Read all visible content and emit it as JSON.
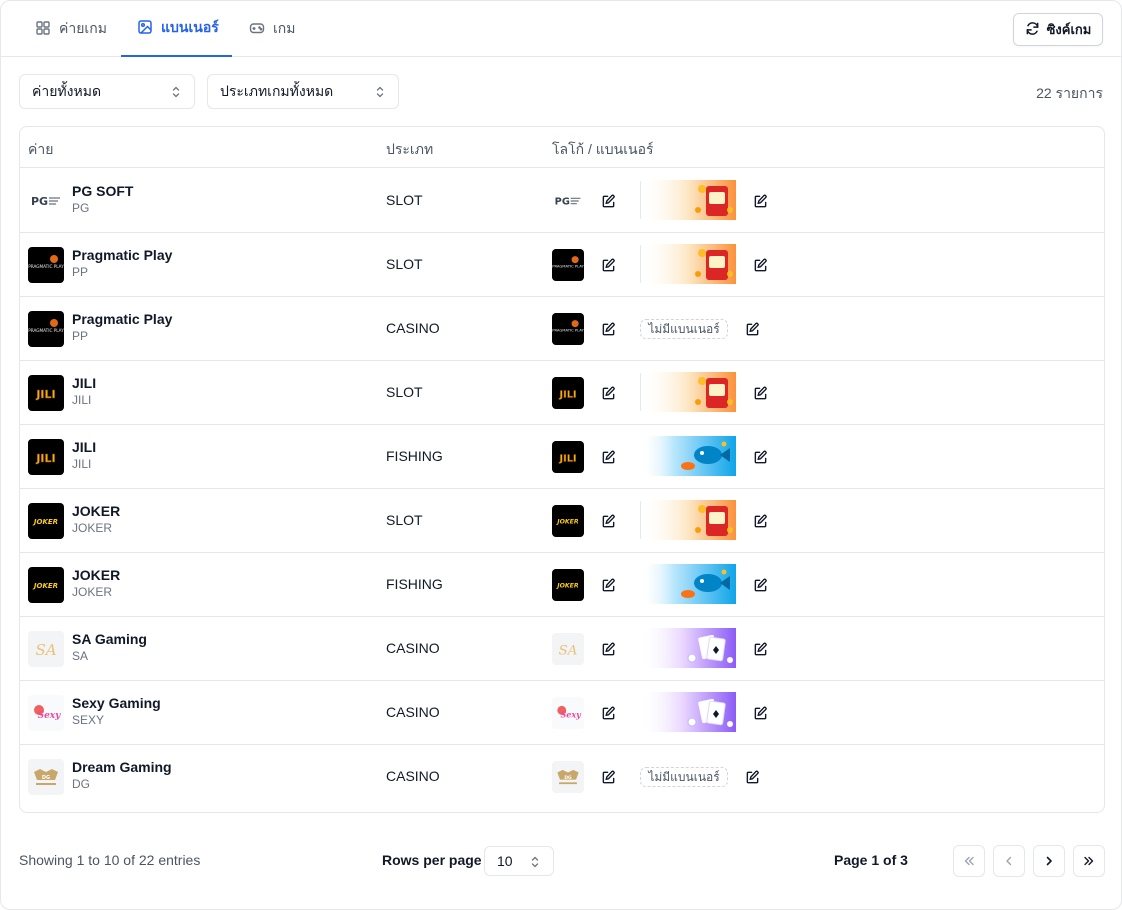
{
  "tabs": [
    {
      "label": "ค่ายเกม",
      "icon": "grid-icon",
      "active": false
    },
    {
      "label": "แบนเนอร์",
      "icon": "image-icon",
      "active": true
    },
    {
      "label": "เกม",
      "icon": "gamepad-icon",
      "active": false
    }
  ],
  "sync_button": {
    "label": "ซิงค์เกม",
    "icon": "refresh-icon"
  },
  "filters": {
    "provider": "ค่ายทั้งหมด",
    "game_type": "ประเภทเกมทั้งหมด"
  },
  "total_count": "22 รายการ",
  "table": {
    "headers": [
      "ค่าย",
      "ประเภท",
      "โลโก้ / แบนเนอร์"
    ],
    "no_banner_label": "ไม่มีแบนเนอร์",
    "rows": [
      {
        "name": "PG SOFT",
        "code": "PG",
        "type": "SLOT",
        "logo": "pg",
        "banner": "slot"
      },
      {
        "name": "Pragmatic Play",
        "code": "PP",
        "type": "SLOT",
        "logo": "pp",
        "banner": "slot"
      },
      {
        "name": "Pragmatic Play",
        "code": "PP",
        "type": "CASINO",
        "logo": "pp",
        "banner": "none"
      },
      {
        "name": "JILI",
        "code": "JILI",
        "type": "SLOT",
        "logo": "jili",
        "banner": "slot"
      },
      {
        "name": "JILI",
        "code": "JILI",
        "type": "FISHING",
        "logo": "jili",
        "banner": "fishing"
      },
      {
        "name": "JOKER",
        "code": "JOKER",
        "type": "SLOT",
        "logo": "joker",
        "banner": "slot"
      },
      {
        "name": "JOKER",
        "code": "JOKER",
        "type": "FISHING",
        "logo": "joker",
        "banner": "fishing"
      },
      {
        "name": "SA Gaming",
        "code": "SA",
        "type": "CASINO",
        "logo": "sa",
        "banner": "casino"
      },
      {
        "name": "Sexy Gaming",
        "code": "SEXY",
        "type": "CASINO",
        "logo": "sexy",
        "banner": "casino"
      },
      {
        "name": "Dream Gaming",
        "code": "DG",
        "type": "CASINO",
        "logo": "dg",
        "banner": "none"
      }
    ]
  },
  "logo_texts": {
    "pg": "PG",
    "pp": "PRAGMATIC PLAY",
    "jili": "JILI",
    "joker": "JOKER",
    "sa": "SA",
    "sexy": "Sexy",
    "dg": "DG"
  },
  "pagination": {
    "showing": "Showing 1 to 10 of 22 entries",
    "rows_per_page_label": "Rows per page",
    "rows_per_page_value": "10",
    "page_info": "Page 1 of 3"
  },
  "colors": {
    "accent": "#2563eb",
    "border": "#e5e7eb",
    "muted": "#6b7280"
  }
}
